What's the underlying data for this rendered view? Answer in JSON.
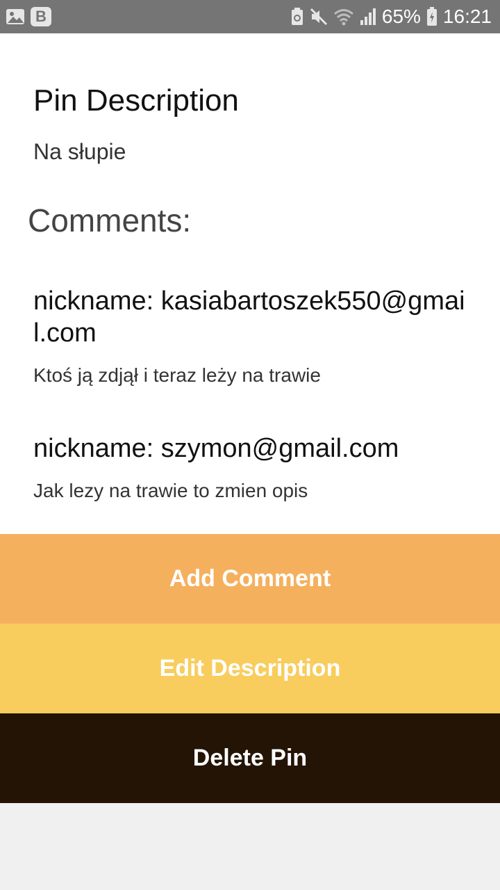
{
  "status_bar": {
    "left_icons": [
      "image-icon",
      "b-app-icon"
    ],
    "b_label": "B",
    "right_icons": [
      "recycle-icon",
      "mute-icon",
      "wifi-icon",
      "signal-icon"
    ],
    "battery": "65%",
    "time": "16:21"
  },
  "pin": {
    "title": "Pin Description",
    "description": "Na słupie"
  },
  "comments": {
    "heading": "Comments:",
    "items": [
      {
        "nickname": "nickname: kasiabartoszek550@gmail.com",
        "text": "Ktoś ją zdjął i teraz leży na trawie"
      },
      {
        "nickname": "nickname: szymon@gmail.com",
        "text": "Jak lezy na trawie to zmien opis"
      }
    ]
  },
  "buttons": {
    "add_comment": "Add Comment",
    "edit_description": "Edit Description",
    "delete_pin": "Delete Pin"
  },
  "colors": {
    "add_comment_bg": "#f5b05e",
    "edit_description_bg": "#f8cd5e",
    "delete_pin_bg": "#231406"
  }
}
